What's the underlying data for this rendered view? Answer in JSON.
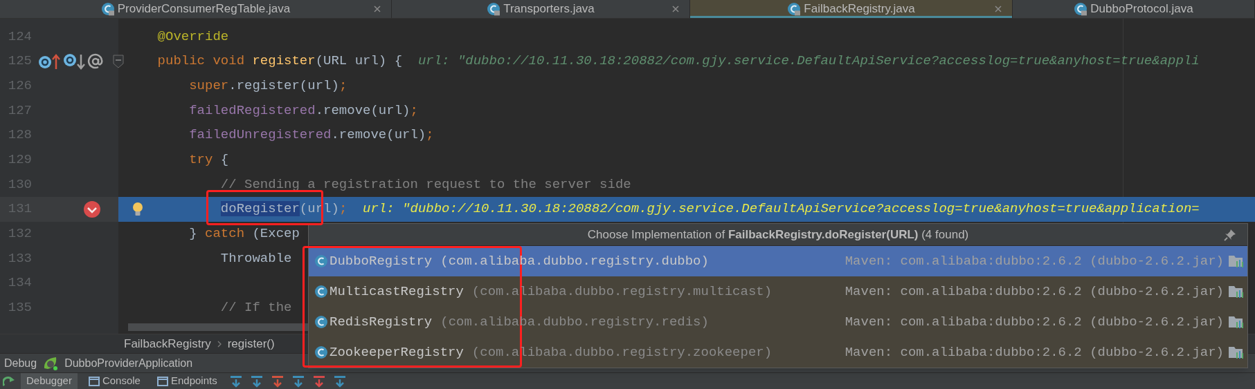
{
  "tabs": [
    {
      "label": "ProviderConsumerRegTable.java",
      "selected": false,
      "closable": true
    },
    {
      "label": "Transporters.java",
      "selected": false,
      "closable": true
    },
    {
      "label": "FailbackRegistry.java",
      "selected": true,
      "closable": true
    },
    {
      "label": "DubboProtocol.java",
      "selected": false,
      "closable": false
    }
  ],
  "editor": {
    "lines": [
      {
        "number": "124",
        "kind": "normal",
        "segments": [
          {
            "kind": "annotation",
            "text": "    @Override"
          }
        ]
      },
      {
        "number": "125",
        "kind": "normal",
        "markers": [
          {
            "kind": "overrides"
          },
          {
            "kind": "implemented"
          },
          {
            "kind": "annotation"
          },
          {
            "kind": "fold"
          }
        ],
        "segments": [
          {
            "kind": "keyword",
            "text": "    public void "
          },
          {
            "kind": "decl",
            "text": "register"
          },
          {
            "kind": "plain",
            "text": "(URL url) {  "
          },
          {
            "kind": "hint",
            "text": "url: \"dubbo://10.11.30.18:20882/com.gjy.service.DefaultApiService?accesslog=true&anyhost=true&appli"
          }
        ]
      },
      {
        "number": "126",
        "kind": "normal",
        "segments": [
          {
            "kind": "keyword",
            "text": "        super"
          },
          {
            "kind": "plain",
            "text": ".register(url)"
          },
          {
            "kind": "keyword",
            "text": ";"
          }
        ]
      },
      {
        "number": "127",
        "kind": "normal",
        "segments": [
          {
            "kind": "field",
            "text": "        failedRegistered"
          },
          {
            "kind": "plain",
            "text": ".remove(url)"
          },
          {
            "kind": "keyword",
            "text": ";"
          }
        ]
      },
      {
        "number": "128",
        "kind": "normal",
        "segments": [
          {
            "kind": "field",
            "text": "        failedUnregistered"
          },
          {
            "kind": "plain",
            "text": ".remove(url)"
          },
          {
            "kind": "keyword",
            "text": ";"
          }
        ]
      },
      {
        "number": "129",
        "kind": "normal",
        "segments": [
          {
            "kind": "keyword",
            "text": "        try"
          },
          {
            "kind": "plain",
            "text": " {"
          }
        ]
      },
      {
        "number": "130",
        "kind": "normal",
        "segments": [
          {
            "kind": "comment",
            "text": "            // Sending a registration request to the server side"
          }
        ]
      },
      {
        "number": "131",
        "kind": "execution",
        "markers": [
          {
            "kind": "breakpoint"
          },
          {
            "kind": "intention"
          }
        ],
        "segments": [
          {
            "kind": "usage",
            "text": "            doRegister"
          },
          {
            "kind": "plain",
            "text": "(url)"
          },
          {
            "kind": "keyword",
            "text": ";"
          },
          {
            "kind": "hint",
            "text": "  url: \"dubbo://10.11.30.18:20882/com.gjy.service.DefaultApiService?accesslog=true&anyhost=true&application="
          }
        ]
      },
      {
        "number": "132",
        "kind": "normal",
        "segments": [
          {
            "kind": "plain",
            "text": "        } "
          },
          {
            "kind": "keyword",
            "text": "catch"
          },
          {
            "kind": "plain",
            "text": " (Excep"
          }
        ]
      },
      {
        "number": "133",
        "kind": "normal",
        "segments": [
          {
            "kind": "plain",
            "text": "            Throwable"
          }
        ]
      },
      {
        "number": "134",
        "kind": "normal"
      },
      {
        "number": "135",
        "kind": "normal",
        "segments": [
          {
            "kind": "comment",
            "text": "            // If the"
          }
        ]
      }
    ]
  },
  "breadcrumb": [
    "FailbackRegistry",
    "register()"
  ],
  "popup": {
    "title": "Choose Implementation of **FailbackRegistry.doRegister(URL)** (4 found)",
    "rows": [
      {
        "name": "DubboRegistry",
        "package": "(com.alibaba.dubbo.registry.dubbo)",
        "library": "Maven: com.alibaba:dubbo:2.6.2 (dubbo-2.6.2.jar)",
        "selected": true
      },
      {
        "name": "MulticastRegistry",
        "package": "(com.alibaba.dubbo.registry.multicast)",
        "library": "Maven: com.alibaba:dubbo:2.6.2 (dubbo-2.6.2.jar)",
        "selected": false
      },
      {
        "name": "RedisRegistry",
        "package": "(com.alibaba.dubbo.registry.redis)",
        "library": "Maven: com.alibaba:dubbo:2.6.2 (dubbo-2.6.2.jar)",
        "selected": false
      },
      {
        "name": "ZookeeperRegistry",
        "package": "(com.alibaba.dubbo.registry.zookeeper)",
        "library": "Maven: com.alibaba:dubbo:2.6.2 (dubbo-2.6.2.jar)",
        "selected": false
      }
    ]
  },
  "debug_bar": {
    "label": "Debug",
    "configuration": "DubboProviderApplication"
  },
  "debug_tabs": [
    {
      "label": "Debugger",
      "selected": true
    },
    {
      "label": "Console",
      "selected": false
    },
    {
      "label": "Endpoints",
      "selected": false
    }
  ]
}
